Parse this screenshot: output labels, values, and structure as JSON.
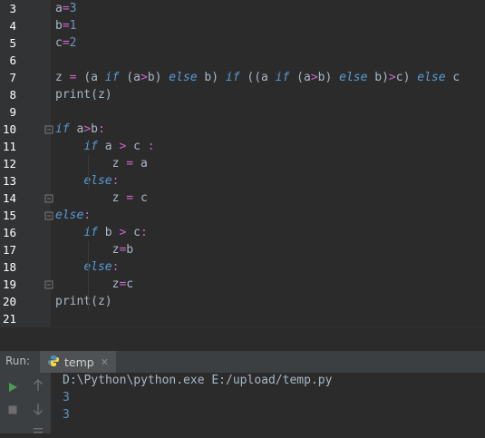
{
  "editor": {
    "lines": [
      {
        "num": "3",
        "code": "a=3"
      },
      {
        "num": "4",
        "code": "b=1"
      },
      {
        "num": "5",
        "code": "c=2"
      },
      {
        "num": "6",
        "code": ""
      },
      {
        "num": "7",
        "code": "z = (a if (a>b) else b) if ((a if (a>b) else b)>c) else c"
      },
      {
        "num": "8",
        "code": "print(z)"
      },
      {
        "num": "9",
        "code": ""
      },
      {
        "num": "10",
        "code": "if a>b:"
      },
      {
        "num": "11",
        "code": "    if a > c :"
      },
      {
        "num": "12",
        "code": "        z = a"
      },
      {
        "num": "13",
        "code": "    else:"
      },
      {
        "num": "14",
        "code": "        z = c"
      },
      {
        "num": "15",
        "code": "else:"
      },
      {
        "num": "16",
        "code": "    if b > c:"
      },
      {
        "num": "17",
        "code": "        z=b"
      },
      {
        "num": "18",
        "code": "    else:"
      },
      {
        "num": "19",
        "code": "        z=c"
      },
      {
        "num": "20",
        "code": "print(z)"
      },
      {
        "num": "21",
        "code": ""
      }
    ]
  },
  "run_panel": {
    "label": "Run:",
    "tab_label": "temp",
    "output": [
      {
        "text": "D:\\Python\\python.exe E:/upload/temp.py",
        "kind": "path"
      },
      {
        "text": "3",
        "kind": "val"
      },
      {
        "text": "3",
        "kind": "val"
      }
    ]
  },
  "icons": [
    "python-icon",
    "close-icon",
    "rerun-icon",
    "stop-icon",
    "scroll-up-icon",
    "scroll-down-icon",
    "fold-icon"
  ],
  "colors": {
    "editor_bg": "#2b2b2b",
    "gutter_bg": "#313335",
    "keyword": "#569cd6",
    "operator": "#cc66cc",
    "number": "#6897bb",
    "text": "#a9b7c6",
    "run_green": "#499c54",
    "output_value": "#5994c3"
  }
}
